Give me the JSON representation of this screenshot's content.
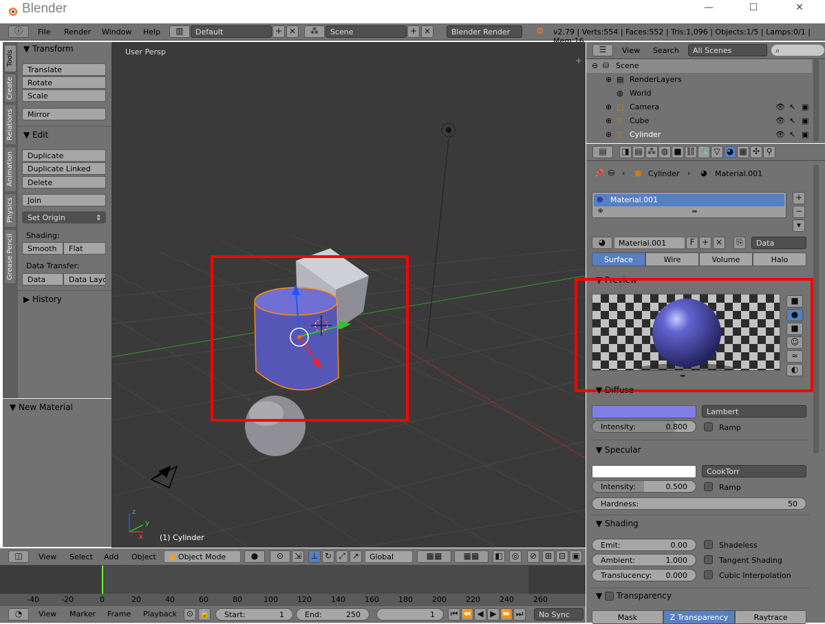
{
  "window": {
    "title": "Blender",
    "minimize": "—",
    "maximize": "☐",
    "close": "✕"
  },
  "info_header": {
    "menus": [
      "File",
      "Render",
      "Window",
      "Help"
    ],
    "layout": "Default",
    "scene": "Scene",
    "engine": "Blender Render",
    "stats": "v2.79 | Verts:554 | Faces:552 | Tris:1,096 | Objects:1/5 | Lamps:0/1 | Mem:16"
  },
  "tool_tabs": [
    "Tools",
    "Create",
    "Relations",
    "Animation",
    "Physics",
    "Grease Pencil"
  ],
  "tools": {
    "transform_header": "Transform",
    "translate": "Translate",
    "rotate": "Rotate",
    "scale": "Scale",
    "mirror": "Mirror",
    "edit_header": "Edit",
    "duplicate": "Duplicate",
    "duplicate_linked": "Duplicate Linked",
    "delete": "Delete",
    "join": "Join",
    "set_origin": "Set Origin",
    "shading_label": "Shading:",
    "smooth": "Smooth",
    "flat": "Flat",
    "data_transfer_label": "Data Transfer:",
    "data": "Data",
    "data_layout": "Data Layo",
    "history_header": "History",
    "new_material": "New Material"
  },
  "viewport": {
    "view_name": "User Persp",
    "object_label": "(1) Cylinder",
    "axis_x": "x",
    "axis_y": "y",
    "axis_z": "z"
  },
  "view3d_header": {
    "menus": [
      "View",
      "Select",
      "Add",
      "Object"
    ],
    "mode": "Object Mode",
    "orientation": "Global"
  },
  "timeline": {
    "ticks": [
      "-40",
      "-20",
      "0",
      "20",
      "40",
      "60",
      "80",
      "100",
      "120",
      "140",
      "160",
      "180",
      "200",
      "220",
      "240",
      "260"
    ],
    "menus": [
      "View",
      "Marker",
      "Frame",
      "Playback"
    ],
    "start_label": "Start:",
    "start_value": "1",
    "end_label": "End:",
    "end_value": "250",
    "current_frame": "1",
    "sync": "No Sync"
  },
  "outliner": {
    "menus": [
      "View",
      "Search"
    ],
    "filter": "All Scenes",
    "rows": [
      "Scene",
      "RenderLayers",
      "World",
      "Camera",
      "Cube",
      "Cylinder"
    ]
  },
  "properties": {
    "breadcrumb_object": "Cylinder",
    "breadcrumb_material": "Material.001",
    "slot_name": "Material.001",
    "material_name": "Material.001",
    "fake_user": "F",
    "link_type": "Data",
    "tabs": [
      "Surface",
      "Wire",
      "Volume",
      "Halo"
    ],
    "preview_header": "Preview",
    "diffuse_header": "Diffuse",
    "diffuse_color": "#7f7fe8",
    "diffuse_shader": "Lambert",
    "diffuse_intensity_label": "Intensity:",
    "diffuse_intensity": "0.800",
    "diffuse_intensity_fraction": 0.8,
    "ramp": "Ramp",
    "specular_header": "Specular",
    "specular_color": "#ffffff",
    "specular_shader": "CookTorr",
    "specular_intensity_label": "Intensity:",
    "specular_intensity": "0.500",
    "specular_intensity_fraction": 0.5,
    "hardness_label": "Hardness:",
    "hardness": "50",
    "shading_header": "Shading",
    "emit_label": "Emit:",
    "emit": "0.00",
    "ambient_label": "Ambient:",
    "ambient": "1.000",
    "translucency_label": "Translucency:",
    "translucency": "0.000",
    "shadeless": "Shadeless",
    "tangent_shading": "Tangent Shading",
    "cubic_interpolation": "Cubic Interpolation",
    "transparency_header": "Transparency",
    "transparency_tabs": [
      "Mask",
      "Z Transparency",
      "Raytrace"
    ]
  },
  "colors": {
    "accent": "#5680c2",
    "highlight": "#ff0000",
    "selected_object": "#ff8c00"
  }
}
